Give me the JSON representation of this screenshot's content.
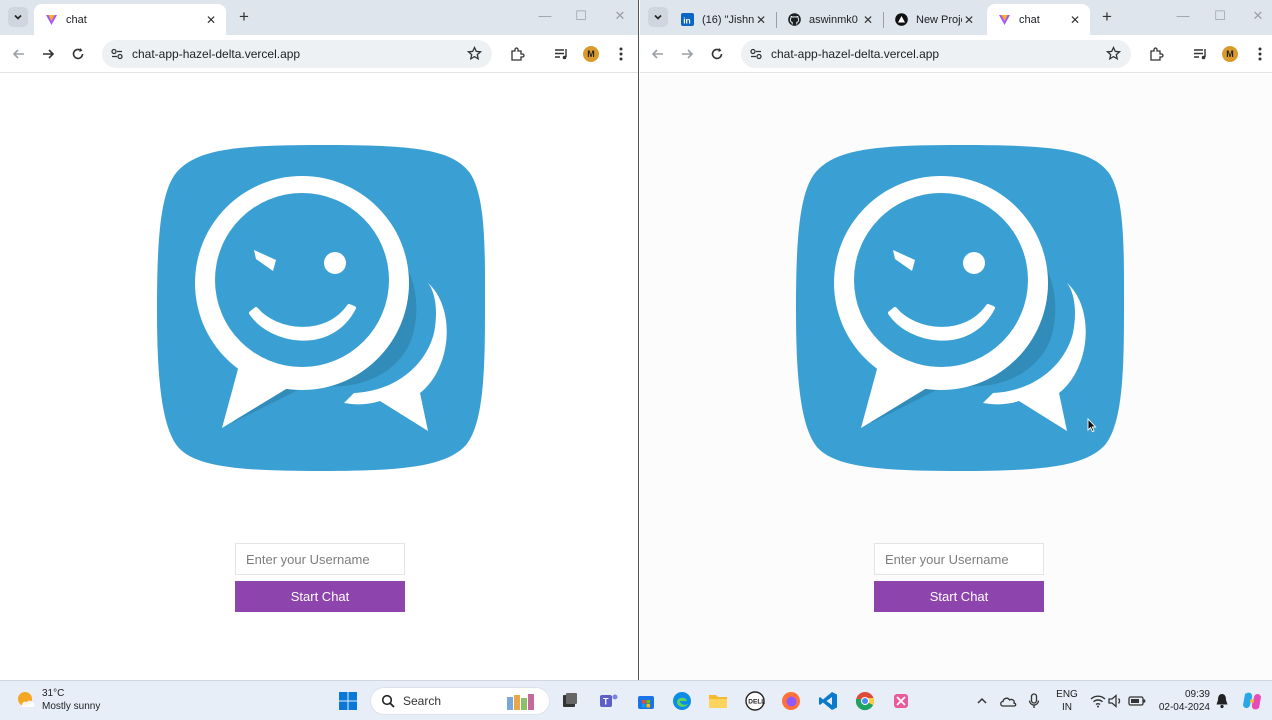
{
  "left_window": {
    "tabs": [
      {
        "title": "chat",
        "active": true
      }
    ],
    "address": "chat-app-hazel-delta.vercel.app",
    "page": {
      "username_placeholder": "Enter your Username",
      "start_button": "Start Chat"
    }
  },
  "right_window": {
    "tabs": [
      {
        "title": "(16) \"Jishn",
        "active": false,
        "favicon": "linkedin-icon"
      },
      {
        "title": "aswinmk0",
        "active": false,
        "favicon": "github-icon"
      },
      {
        "title": "New Proje",
        "active": false,
        "favicon": "vercel-icon"
      },
      {
        "title": "chat",
        "active": true,
        "favicon": "chat-app-icon"
      }
    ],
    "address": "chat-app-hazel-delta.vercel.app",
    "page": {
      "username_placeholder": "Enter your Username",
      "start_button": "Start Chat"
    }
  },
  "profile_initial": "M",
  "taskbar": {
    "weather_temp": "31°C",
    "weather_desc": "Mostly sunny",
    "search_label": "Search",
    "language_top": "ENG",
    "language_bottom": "IN",
    "time": "09:39",
    "date": "02-04-2024"
  },
  "colors": {
    "logo_blue": "#3aa0d4",
    "button_purple": "#8e44ad",
    "tabbar": "#dfe5ec"
  }
}
